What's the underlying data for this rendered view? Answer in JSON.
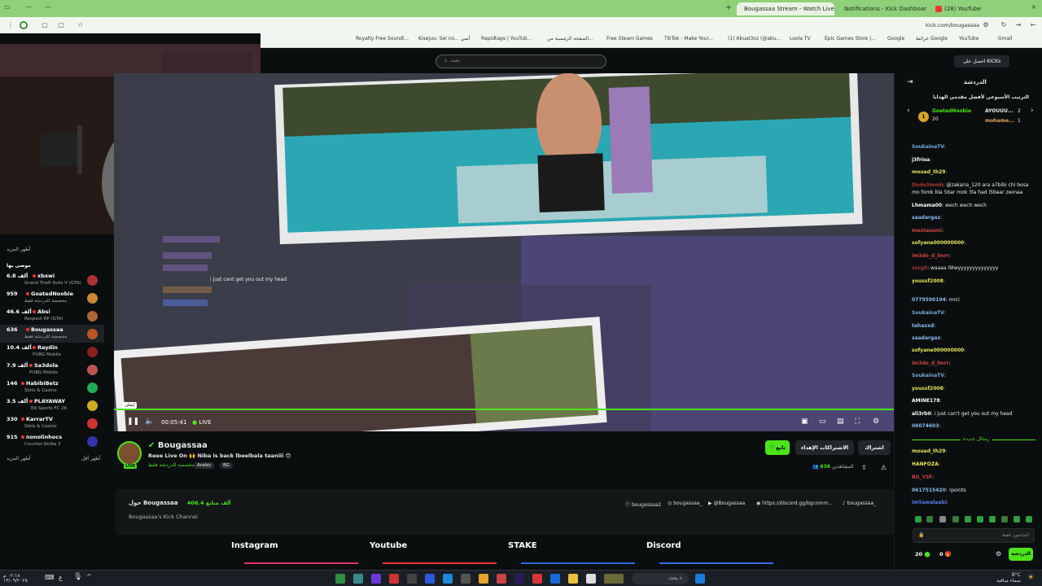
{
  "browser": {
    "tabs": [
      {
        "label": "(28) YouTube",
        "active": false
      },
      {
        "label": "Notifications - Kick Dashboard",
        "active": false
      },
      {
        "label": "Bougassaa Stream - Watch Live",
        "active": true
      }
    ],
    "url": "kick.com/bougassaa",
    "bookmarks": [
      "Royalty Free Soundi...",
      "Kisejuu: Sei no... أنمي",
      "Rapidtags | YouTub...",
      "الصفحة الرئيسية من...",
      "Free Steam Games",
      "TikTok - Make Your...",
      "(1) Abual3oz (@abu...",
      "Loola TV",
      "Epic Games Store |...",
      "Google",
      "خرائط Google",
      "YouTube",
      "Gmail"
    ]
  },
  "header": {
    "search_placeholder": "بحث",
    "get_kicks": "احصل على KICKs"
  },
  "sidebar": {
    "title": "أظهر المزيد",
    "section": "موصى بها",
    "show_more": "أظهر المزيد",
    "show_less": "أظهر أقل",
    "channels": [
      {
        "name": "xbxwi",
        "viewers": "6.8 ألف",
        "category": "Grand Theft Auto V (GTA)",
        "color": "#a33"
      },
      {
        "name": "GoatedNoobie",
        "viewers": "959",
        "category": "مخصصة للدردشة فقط",
        "color": "#c83"
      },
      {
        "name": "Absi",
        "viewers": "46.6 ألف",
        "category": "Respect RP (GTA)",
        "color": "#a63"
      },
      {
        "name": "Bougassaa",
        "viewers": "636",
        "category": "مخصصة للدردشة فقط",
        "color": "#b52",
        "selected": true
      },
      {
        "name": "Raydin",
        "viewers": "10.4 ألف",
        "category": "PUBG Mobile",
        "color": "#822"
      },
      {
        "name": "Sa3dola",
        "viewers": "7.9 ألف",
        "category": "PUBG Mobile",
        "color": "#b55"
      },
      {
        "name": "HabibiBetz",
        "viewers": "146",
        "category": "Slots & Casino",
        "color": "#2a5"
      },
      {
        "name": "PLAYAWAY",
        "viewers": "3.5 ألف",
        "category": "EA Sports FC 26",
        "color": "#ca2"
      },
      {
        "name": "KarrarTV",
        "viewers": "330",
        "category": "Slots & Casino",
        "color": "#c33"
      },
      {
        "name": "nonolinhocs",
        "viewers": "915",
        "category": "Counter-Strike 2",
        "color": "#33a"
      }
    ]
  },
  "player": {
    "time": "00:05:41",
    "live": "LIVE",
    "overlay_text": "i just cant get you out my head",
    "pause_tooltip": "إيقاف"
  },
  "channel": {
    "name": "Bougassaa",
    "title": "Reee Live On 🙌 Niba is back lbeelbala taaniii 😍",
    "category": "مخصصة للدردشة فقط",
    "tags": [
      "Arabic",
      "BG"
    ],
    "follow": "تابع",
    "subscribe": "الاشتراكات الإهداء",
    "gift": "اشتراك",
    "viewers": "636",
    "viewers_label": "المشاهدين",
    "live_badge": "LIVE"
  },
  "about": {
    "heading": "حول Bougassaa",
    "followers": "406.4 ألف متابع",
    "description": "Bougassaa's Kick Channel",
    "socials": [
      "bougassaa2",
      "bougassaa_",
      "@Bougassaa",
      "https://discord.gg/bgcomm...",
      "bougassaa_"
    ]
  },
  "panels": [
    {
      "label": "Instagram",
      "color": "#e3346a"
    },
    {
      "label": "Youtube",
      "color": "#e33"
    },
    {
      "label": "STAKE",
      "color": "#2a6ad8"
    },
    {
      "label": "Discord",
      "color": "#3a6ae8"
    }
  ],
  "chat": {
    "title": "الدردشة",
    "leaderboard_title": "الترتيب الأسبوعي لأفضل مقدمي الهدايا",
    "leaders": [
      {
        "name": "GoatedNoobie",
        "count": "20"
      },
      {
        "name": "AYOUUU...",
        "count": "2"
      },
      {
        "name": "mohame...",
        "count": "1"
      }
    ],
    "messages": [
      {
        "user": "SoukainaTV",
        "text": "",
        "color": "#7ad"
      },
      {
        "user": "j3frioa",
        "text": "",
        "color": "#fff"
      },
      {
        "user": "mouad_th29",
        "text": "",
        "color": "#e5e55a"
      },
      {
        "user": "Dodo3mmh",
        "text": "@zakaria_120 ara a7bibi chi bosa mn fomk bla 5bar mok 3la had l5baar zwinaa",
        "color": "#a33"
      },
      {
        "user": "Lhmama00",
        "text": "wech wech wech",
        "color": "#fff"
      },
      {
        "user": "saadargaz",
        "text": "",
        "color": "#8be"
      },
      {
        "user": "mostasomi",
        "text": "",
        "color": "#c44"
      },
      {
        "user": "sofyane000000000",
        "text": "",
        "color": "#e5e55a"
      },
      {
        "user": "im3do_d_lmrr",
        "text": "",
        "color": "#c44"
      },
      {
        "user": "serg8",
        "text": "waaaa l9lwyyyyyyyyyyyyyy",
        "color": "#a33"
      },
      {
        "user": "youssf2008",
        "text": "",
        "color": "#e5e55a"
      },
      {
        "user": "0779590194",
        "text": "mrci",
        "color": "#8be"
      },
      {
        "user": "SoukainaTV",
        "text": "",
        "color": "#7ad"
      },
      {
        "user": "tahaxxd",
        "text": "",
        "color": "#8be"
      },
      {
        "user": "saadargaz",
        "text": "",
        "color": "#8be"
      },
      {
        "user": "sofyane000000000",
        "text": "",
        "color": "#e5e55a"
      },
      {
        "user": "im3do_d_lmrr",
        "text": "",
        "color": "#c44"
      },
      {
        "user": "SoukainaTV",
        "text": "",
        "color": "#7ad"
      },
      {
        "user": "youssf2008",
        "text": "",
        "color": "#e5e55a"
      },
      {
        "user": "AMINE178",
        "text": "",
        "color": "#fff"
      },
      {
        "user": "ali3rb0",
        "text": "i just can't get you out my head",
        "color": "#fff"
      },
      {
        "user": "06074603",
        "text": "",
        "color": "#8be"
      }
    ],
    "new_messages": "رسائل جديدة",
    "later_messages": [
      {
        "user": "mouad_th29",
        "text": "",
        "color": "#e5e55a"
      },
      {
        "user": "HANFOZA",
        "text": "",
        "color": "#e5e55a"
      },
      {
        "user": "BG_YSF",
        "text": "",
        "color": "#c44"
      },
      {
        "user": "0617515420",
        "text": "!points",
        "color": "#8be"
      },
      {
        "user": "im5awalaabi",
        "text": "",
        "color": "#5a7ae8"
      }
    ],
    "input_placeholder": "المتابعون فقط",
    "send": "الدردشة",
    "points": "20",
    "subs": "0"
  },
  "taskbar": {
    "search": "بحث",
    "time": "٠٢:١٨ م",
    "date": "١٣/٠٩/٢٠٢٥",
    "weather_temp": "8°C",
    "weather_desc": "سماء صافية"
  }
}
